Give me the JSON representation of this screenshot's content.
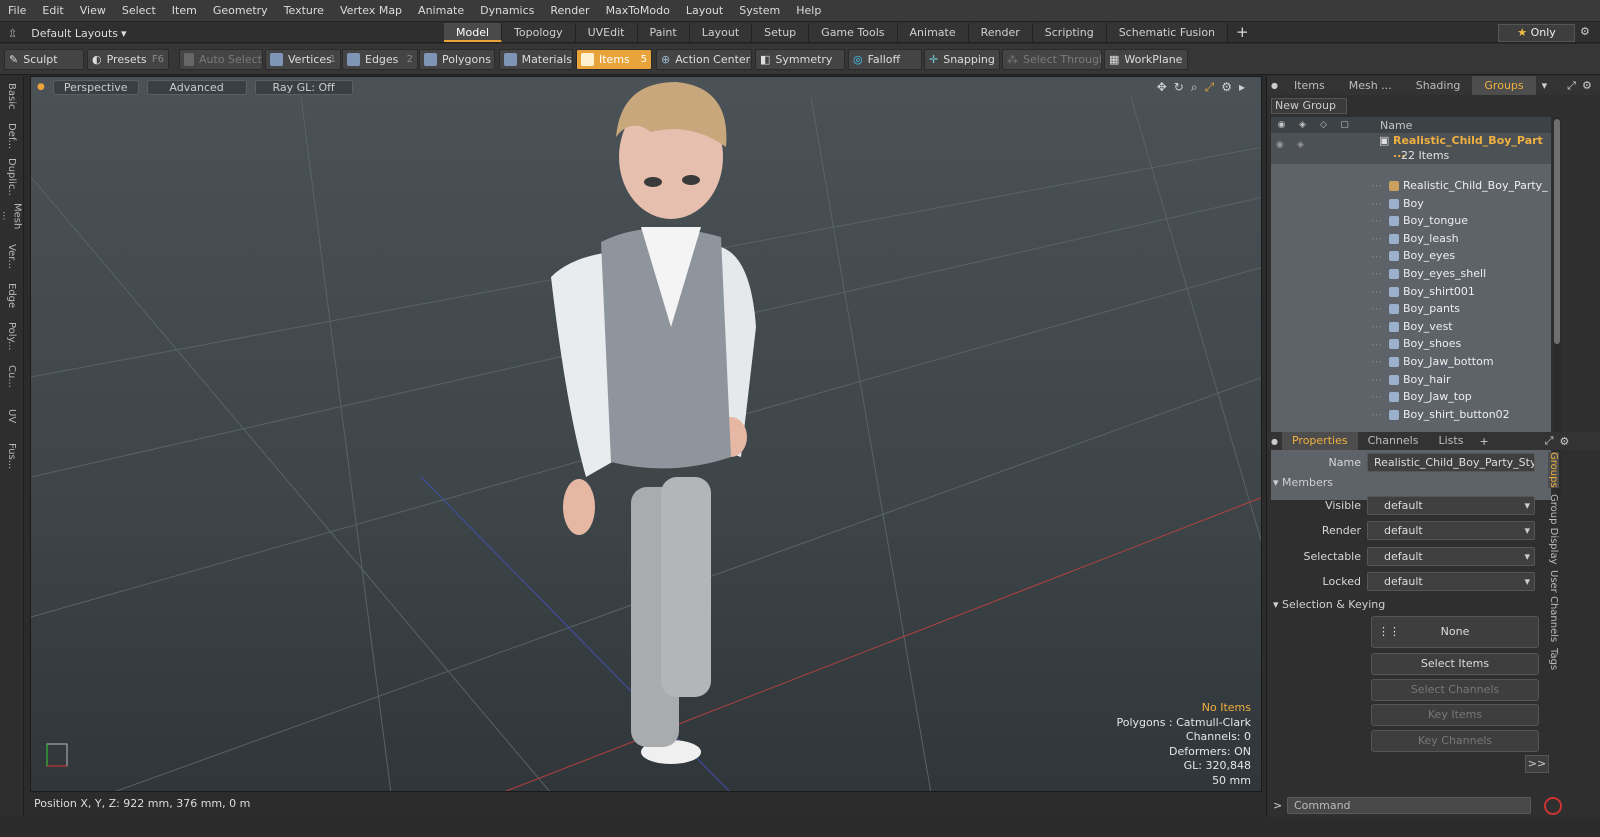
{
  "menu": [
    "File",
    "Edit",
    "View",
    "Select",
    "Item",
    "Geometry",
    "Texture",
    "Vertex Map",
    "Animate",
    "Dynamics",
    "Render",
    "MaxToModo",
    "Layout",
    "System",
    "Help"
  ],
  "layouts_label": "Default Layouts",
  "mode_tabs": [
    "Model",
    "Topology",
    "UVEdit",
    "Paint",
    "Layout",
    "Setup",
    "Game Tools",
    "Animate",
    "Render",
    "Scripting",
    "Schematic Fusion"
  ],
  "only_label": "Only",
  "toolbar": {
    "sculpt": "Sculpt",
    "presets": "Presets",
    "presets_key": "F6",
    "auto_select": "Auto Select",
    "vertices": "Vertices",
    "vertices_key": "1",
    "edges": "Edges",
    "edges_key": "2",
    "polygons": "Polygons",
    "materials": "Materials",
    "items": "Items",
    "items_key": "5",
    "action_center": "Action Center",
    "symmetry": "Symmetry",
    "falloff": "Falloff",
    "snapping": "Snapping",
    "select_through": "Select Through",
    "workplane": "WorkPlane"
  },
  "left_tabs": [
    "Basic",
    "Def...",
    "Duplic...",
    "Mesh ...",
    "Ver...",
    "Edge",
    "Poly...",
    "Cu...",
    "UV",
    "Fus..."
  ],
  "viewport": {
    "perspective": "Perspective",
    "advanced": "Advanced",
    "raygl": "Ray GL: Off",
    "stats": {
      "no_items": "No Items",
      "polygons": "Polygons : Catmull-Clark",
      "channels": "Channels: 0",
      "deformers": "Deformers: ON",
      "gl": "GL: 320,848",
      "scale": "50 mm"
    }
  },
  "status": {
    "position": "Position X, Y, Z:  922 mm, 376 mm, 0 m"
  },
  "right_tabs": [
    "Items",
    "Mesh ...",
    "Shading",
    "Groups"
  ],
  "new_group": "New Group",
  "tree": {
    "name_col": "Name",
    "group_name": "Realistic_Child_Boy_Part ...",
    "group_count": "22 Items",
    "items": [
      "Realistic_Child_Boy_Party_ ...",
      "Boy",
      "Boy_tongue",
      "Boy_leash",
      "Boy_eyes",
      "Boy_eyes_shell",
      "Boy_shirt001",
      "Boy_pants",
      "Boy_vest",
      "Boy_shoes",
      "Boy_Jaw_bottom",
      "Boy_hair",
      "Boy_Jaw_top",
      "Boy_shirt_button02"
    ]
  },
  "prop_tabs": [
    "Properties",
    "Channels",
    "Lists"
  ],
  "props": {
    "name_label": "Name",
    "name_value": "Realistic_Child_Boy_Party_Style (",
    "members": "Members",
    "visible": "Visible",
    "render": "Render",
    "selectable": "Selectable",
    "locked": "Locked",
    "default": "default",
    "sel_keying": "Selection & Keying",
    "none": "None",
    "select_items": "Select Items",
    "select_channels": "Select Channels",
    "key_items": "Key Items",
    "key_channels": "Key Channels",
    "more": ">>"
  },
  "side_vtabs": [
    "Groups",
    "Group Display",
    "User Channels",
    "Tags"
  ],
  "command_placeholder": "Command",
  "colors": {
    "accent": "#e8a33a",
    "group_text": "#f0b040"
  }
}
